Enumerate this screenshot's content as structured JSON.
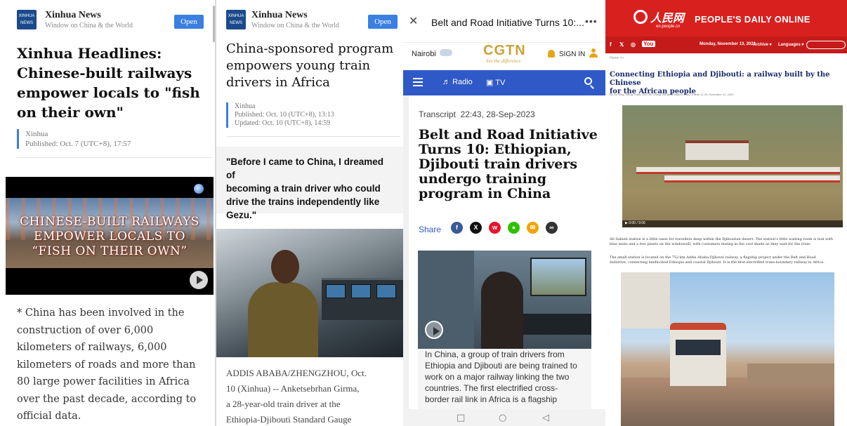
{
  "panel1": {
    "app_name": "Xinhua News",
    "app_tagline": "Window on China & the World",
    "open_label": "Open",
    "logo_text": "XINHUA NEWS",
    "headline_lines": [
      "Xinhua Headlines:",
      "Chinese-built railways",
      "empower locals to \"fish",
      "on their own\""
    ],
    "source": "Xinhua",
    "published": "Published: Oct. 7 (UTC+8), 17:57",
    "video_title_lines": [
      "CHINESE-BUILT RAILWAYS",
      "EMPOWER LOCALS TO",
      "“FISH ON THEIR OWN”"
    ],
    "body_lines": [
      "* China has been involved in the",
      "construction of over 6,000",
      "kilometers of railways, 6,000",
      "kilometers of roads and more than",
      "80 large power facilities in Africa",
      "over the past decade, according to",
      "official data."
    ]
  },
  "panel2": {
    "app_name": "Xinhua News",
    "app_tagline": "Window on China & the World",
    "open_label": "Open",
    "logo_text": "XINHUA NEWS",
    "headline_lines": [
      "China-sponsored program",
      "empowers young train",
      "drivers in Africa"
    ],
    "source": "Xinhua",
    "published": "Published: Oct. 10 (UTC+8), 13:13",
    "updated": "Updated: Oct. 10 (UTC+8), 14:59",
    "quote_lines": [
      "\"Before I came to China, I dreamed of",
      "becoming a train driver who could",
      "drive the trains independently like",
      "Gezu.\""
    ],
    "body_lines": [
      "ADDIS ABABA/ZHENGZHOU, Oct.",
      "10 (Xinhua) -- Anketsebrhan Girma,",
      "a 28-year-old train driver at the",
      "Ethiopia-Djibouti Standard Gauge"
    ]
  },
  "panel3": {
    "close_glyph": "✕",
    "tab_title": "Belt and Road Initiative Turns 10:...",
    "more_glyph": "•••",
    "city": "Nairobi",
    "logo": "CGTN",
    "logo_tagline": "See the difference",
    "sign_in": "SIGN IN",
    "nav_radio": "Radio",
    "nav_tv": "TV",
    "transcript_label": "Transcript",
    "timestamp": "22:43, 28-Sep-2023",
    "headline_lines": [
      "Belt and Road Initiative",
      "Turns 10: Ethiopian,",
      "Djibouti train drivers",
      "undergo training",
      "program in China"
    ],
    "share_label": "Share",
    "share_icons": [
      {
        "name": "facebook-icon",
        "glyph": "f",
        "color": "#3b5998"
      },
      {
        "name": "x-icon",
        "glyph": "X",
        "color": "#111111"
      },
      {
        "name": "weibo-icon",
        "glyph": "w",
        "color": "#e6162d"
      },
      {
        "name": "wechat-icon",
        "glyph": "●",
        "color": "#2dc100"
      },
      {
        "name": "email-icon",
        "glyph": "✉",
        "color": "#f0a500"
      },
      {
        "name": "link-icon",
        "glyph": "∞",
        "color": "#333333"
      }
    ],
    "caption_lines": [
      "In China, a group of train drivers from",
      "Ethiopia and Djibouti are being trained to",
      "work on a major railway linking the two",
      "countries. The first electrified cross-",
      "border rail link in Africa is a flagship"
    ],
    "nav_square": "□",
    "nav_circle": "○",
    "nav_back": "◁"
  },
  "panel4": {
    "brand_cn": "人民网",
    "brand_cn_sub": "en.people.cn",
    "brand": "PEOPLE'S DAILY ONLINE",
    "social": [
      "f",
      "𝕏",
      "◎",
      "You"
    ],
    "date": "Monday, November 13, 2023",
    "archive": "Archive ▾",
    "languages": "Languages ▾",
    "crumb": "Home >>",
    "title_lines": [
      "Connecting Ethiopia and Djibouti: a railway built by the Chinese",
      "for the African people"
    ],
    "byline": "By Liu Ning, Wang Yutao, Kou Jie, Zhang Wenjie (People's Daily Online) 11:25, November 13, 2023",
    "video_time": "▶  0:00 / 9:06",
    "para1_lines": [
      "Ali Sabieh station is a little oasis for travellers deep within the Djiboutian desert. The station's little waiting room is teal with",
      "blue seats and a few plants on the windowsill, with customers dozing in the cool shade as they wait for the train."
    ],
    "para2_lines": [
      "The small station is located on the 752-km Addis Ababa-Djibouti railway, a flagship project under the Belt and Road",
      "Initiative, connecting landlocked Ethiopia and coastal Djibouti. It is the first electrified trans-boundary railway in Africa."
    ]
  },
  "colors": {
    "xinhua_blue": "#3b7fe0",
    "cgtn_blue": "#2f59c6",
    "cgtn_gold": "#c9a23a",
    "peoples_red": "#d8211f",
    "pd_title_blue": "#1a2a6b"
  }
}
